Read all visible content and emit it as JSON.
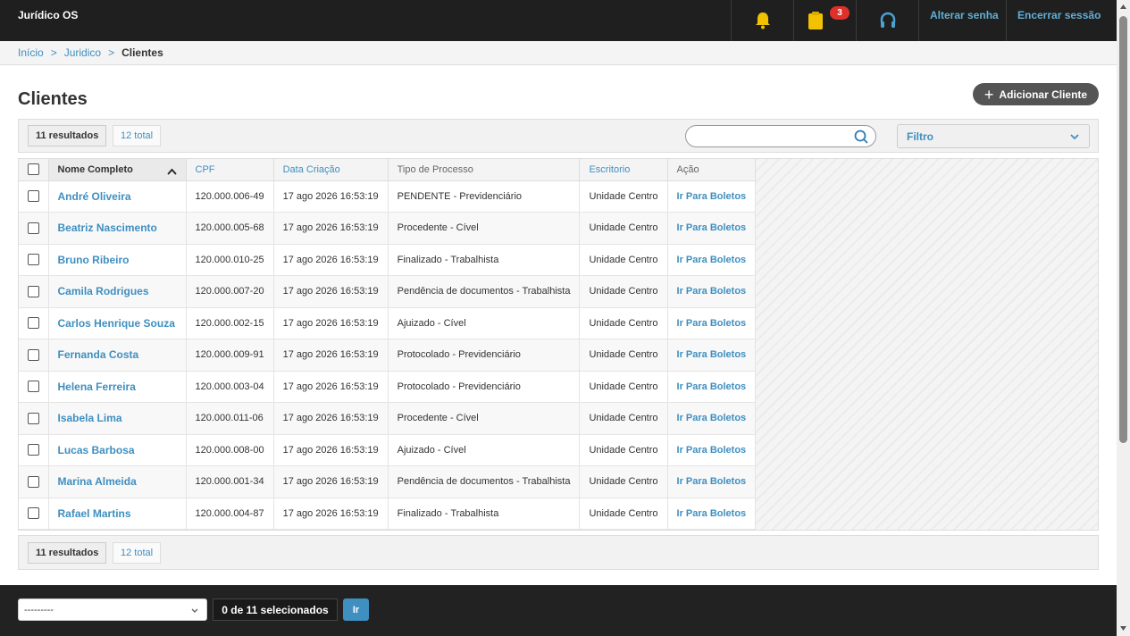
{
  "header": {
    "brand": "Jurídico OS",
    "notifications_count": "3",
    "change_password": "Alterar senha",
    "logout": "Encerrar sessão",
    "icons": [
      "bell-icon",
      "clipboard-icon",
      "headset-icon"
    ]
  },
  "breadcrumb": {
    "home": "Início",
    "section": "Juridico",
    "current": "Clientes",
    "separator": ">"
  },
  "page": {
    "title": "Clientes",
    "add_button": "Adicionar Cliente",
    "add_icon": "+"
  },
  "summary": {
    "results": "11 resultados",
    "total": "12 total"
  },
  "search": {
    "placeholder": ""
  },
  "filter": {
    "label": "Filtro"
  },
  "table": {
    "columns": {
      "name": "Nome Completo",
      "cpf": "CPF",
      "created": "Data Criação",
      "process": "Tipo de Processo",
      "office": "Escritorio",
      "action": "Ação"
    },
    "rows": [
      {
        "name": "André Oliveira",
        "cpf": "120.000.006-49",
        "created": "17 ago 2026 16:53:19",
        "process": "PENDENTE - Previdenciário",
        "office": "Unidade Centro",
        "action": "Ir Para Boletos"
      },
      {
        "name": "Beatriz Nascimento",
        "cpf": "120.000.005-68",
        "created": "17 ago 2026 16:53:19",
        "process": "Procedente - Cível",
        "office": "Unidade Centro",
        "action": "Ir Para Boletos"
      },
      {
        "name": "Bruno Ribeiro",
        "cpf": "120.000.010-25",
        "created": "17 ago 2026 16:53:19",
        "process": "Finalizado - Trabalhista",
        "office": "Unidade Centro",
        "action": "Ir Para Boletos"
      },
      {
        "name": "Camila Rodrigues",
        "cpf": "120.000.007-20",
        "created": "17 ago 2026 16:53:19",
        "process": "Pendência de documentos - Trabalhista",
        "office": "Unidade Centro",
        "action": "Ir Para Boletos"
      },
      {
        "name": "Carlos Henrique Souza",
        "cpf": "120.000.002-15",
        "created": "17 ago 2026 16:53:19",
        "process": "Ajuizado - Cível",
        "office": "Unidade Centro",
        "action": "Ir Para Boletos"
      },
      {
        "name": "Fernanda Costa",
        "cpf": "120.000.009-91",
        "created": "17 ago 2026 16:53:19",
        "process": "Protocolado - Previdenciário",
        "office": "Unidade Centro",
        "action": "Ir Para Boletos"
      },
      {
        "name": "Helena Ferreira",
        "cpf": "120.000.003-04",
        "created": "17 ago 2026 16:53:19",
        "process": "Protocolado - Previdenciário",
        "office": "Unidade Centro",
        "action": "Ir Para Boletos"
      },
      {
        "name": "Isabela Lima",
        "cpf": "120.000.011-06",
        "created": "17 ago 2026 16:53:19",
        "process": "Procedente - Cível",
        "office": "Unidade Centro",
        "action": "Ir Para Boletos"
      },
      {
        "name": "Lucas Barbosa",
        "cpf": "120.000.008-00",
        "created": "17 ago 2026 16:53:19",
        "process": "Ajuizado - Cível",
        "office": "Unidade Centro",
        "action": "Ir Para Boletos"
      },
      {
        "name": "Marina Almeida",
        "cpf": "120.000.001-34",
        "created": "17 ago 2026 16:53:19",
        "process": "Pendência de documentos - Trabalhista",
        "office": "Unidade Centro",
        "action": "Ir Para Boletos"
      },
      {
        "name": "Rafael Martins",
        "cpf": "120.000.004-87",
        "created": "17 ago 2026 16:53:19",
        "process": "Finalizado - Trabalhista",
        "office": "Unidade Centro",
        "action": "Ir Para Boletos"
      }
    ]
  },
  "bulk": {
    "action_value": "---------",
    "selected": "0 de 11 selecionados",
    "go": "Ir"
  },
  "colors": {
    "header_bg": "#1f1f1f",
    "link": "#3f8fc0",
    "bell": "#f2c200",
    "badge": "#e0302a",
    "headset": "#4aa3d4"
  }
}
